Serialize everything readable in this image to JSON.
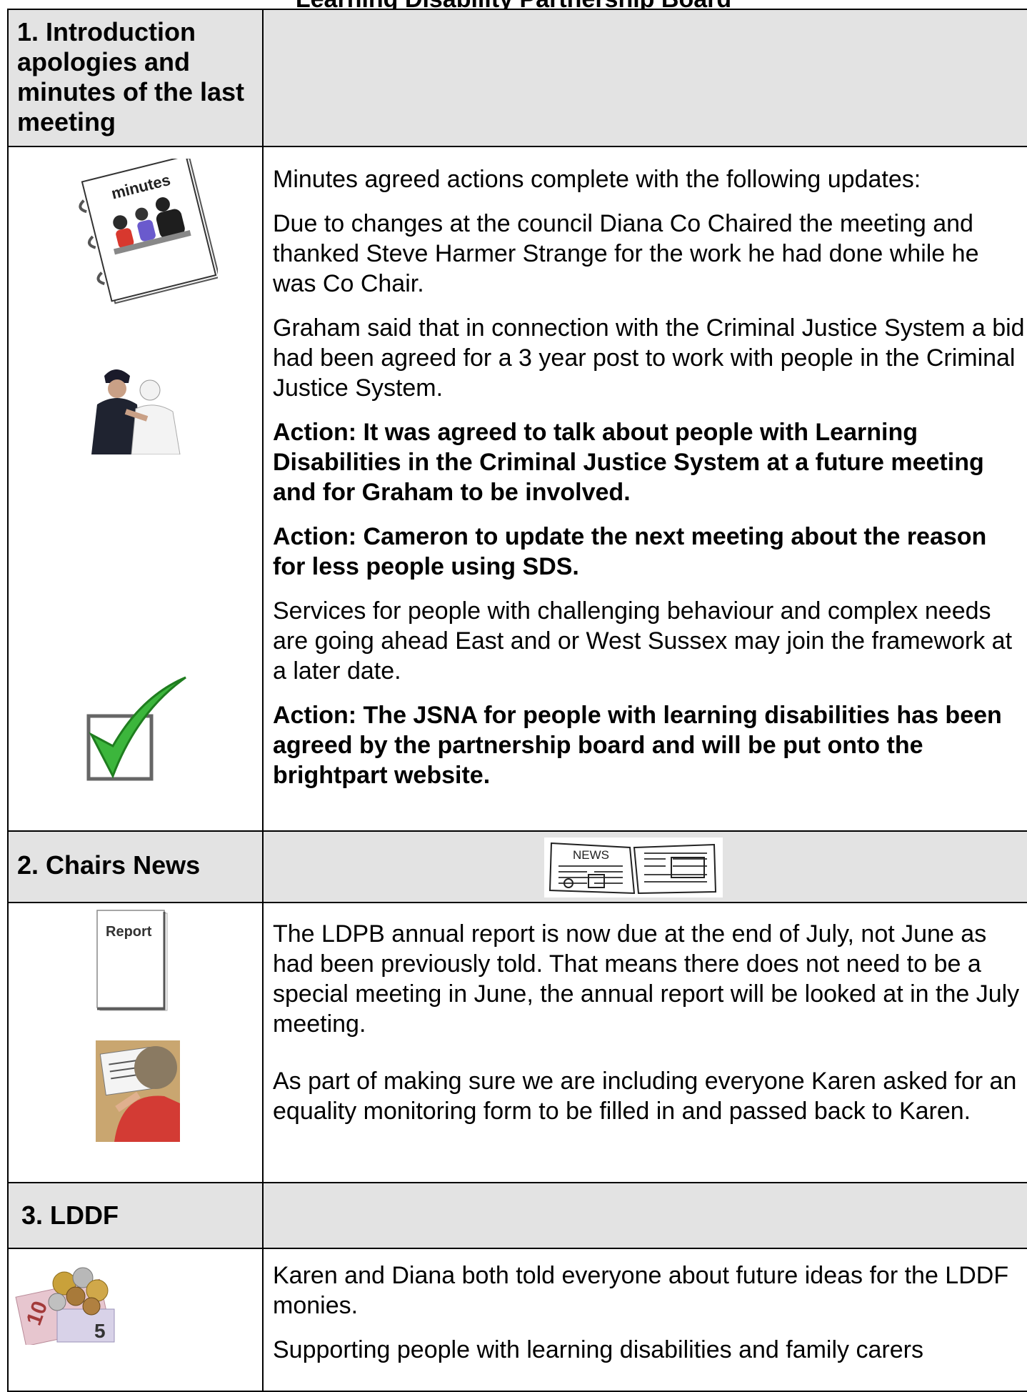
{
  "page_header": "Learning Disability Partnership Board",
  "sections": [
    {
      "title": "1. Introduction apologies and minutes of the last meeting",
      "paragraphs": [
        {
          "text": "Minutes agreed actions complete with the following updates:",
          "bold": false
        },
        {
          "text": "Due to changes at the council Diana Co Chaired the meeting and thanked Steve Harmer Strange for the work he had done while he was Co Chair.",
          "bold": false
        },
        {
          "text": "Graham said that in connection with the Criminal Justice System a bid had been agreed for a 3 year post to work with people in the Criminal Justice System.",
          "bold": false
        },
        {
          "text": "Action: It was agreed to talk about people with Learning Disabilities in the Criminal Justice System at a future meeting and for Graham to be involved.",
          "bold": true
        },
        {
          "text": "Action: Cameron to update the next meeting about the reason for less people using SDS.",
          "bold": true
        },
        {
          "text": "Services for people with challenging behaviour and complex needs are going ahead East and or West Sussex may join the framework at a later date.",
          "bold": false
        },
        {
          "text": "Action: The JSNA for people with learning disabilities has been agreed by the partnership board and will be put onto the brightpart website.",
          "bold": true
        }
      ]
    },
    {
      "title": "2. Chairs News",
      "paragraphs": [
        {
          "text": "The LDPB annual report is now due at the end of July, not June as had been previously told.  That means there does not need to be a special meeting in June, the annual report will be looked at in the July meeting.",
          "bold": false
        },
        {
          "text": "As part of making sure we are including everyone Karen asked for an equality monitoring form to be filled in and passed back to Karen.",
          "bold": false
        }
      ]
    },
    {
      "title": "3. LDDF",
      "paragraphs": [
        {
          "text": "Karen and Diana both told everyone about future ideas for the LDDF monies.",
          "bold": false
        },
        {
          "text": "Supporting people with learning disabilities and family carers",
          "bold": false
        }
      ]
    }
  ],
  "image_labels": {
    "minutes": "minutes",
    "news": "NEWS",
    "report": "Report",
    "banknote": "10",
    "coin": "5"
  },
  "colors": {
    "header_fill": "#e3e3e3",
    "tick_green": "#3cb63c",
    "border": "#000000"
  }
}
